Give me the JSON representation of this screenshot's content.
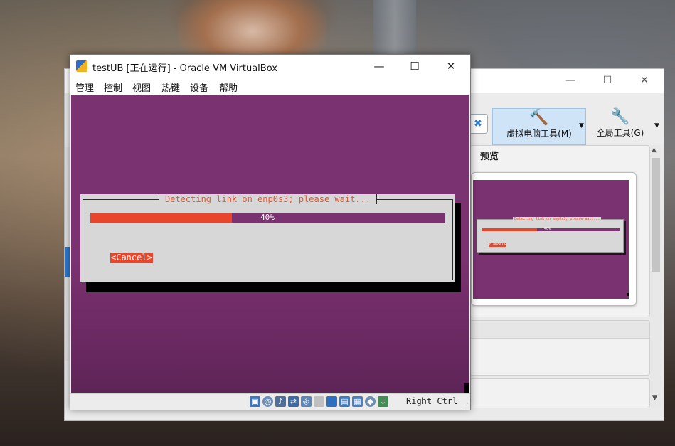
{
  "vm_window": {
    "title": "testUB [正在运行] - Oracle VM VirtualBox",
    "controls": {
      "minimize": "—",
      "maximize": "☐",
      "close": "✕"
    },
    "menu": [
      "管理",
      "控制",
      "视图",
      "热键",
      "设备",
      "帮助"
    ],
    "status": {
      "host_key": "Right Ctrl"
    }
  },
  "installer_dialog": {
    "title": "Detecting link on enp0s3; please wait...",
    "progress": 0.4,
    "progress_label": "40%",
    "cancel_label": "<Cancel>"
  },
  "manager": {
    "controls": {
      "minimize": "—",
      "maximize": "☐",
      "close": "✕"
    },
    "tools": {
      "machine_tools": "虚拟电脑工具(M)",
      "global_tools": "全局工具(G)"
    },
    "preview": {
      "title": "预览",
      "mini_title": "Detecting link on enp0s3; please wait...",
      "mini_pct": "40%",
      "mini_cancel": "<Cancel>"
    }
  },
  "colors": {
    "vm_background": "#7b3270",
    "progress_fill": "#e9452a",
    "dialog_bg": "#d7d7d7",
    "title_text": "#e2572f"
  },
  "icons": [
    "app-icon",
    "wrench-icon",
    "global-tools-icon",
    "hdd-icon",
    "optical-icon",
    "audio-icon",
    "network-icon",
    "usb-icon",
    "shared-folder-icon",
    "display-icon",
    "recording-icon",
    "cpu-icon",
    "mouse-integration-icon",
    "keyboard-icon"
  ]
}
